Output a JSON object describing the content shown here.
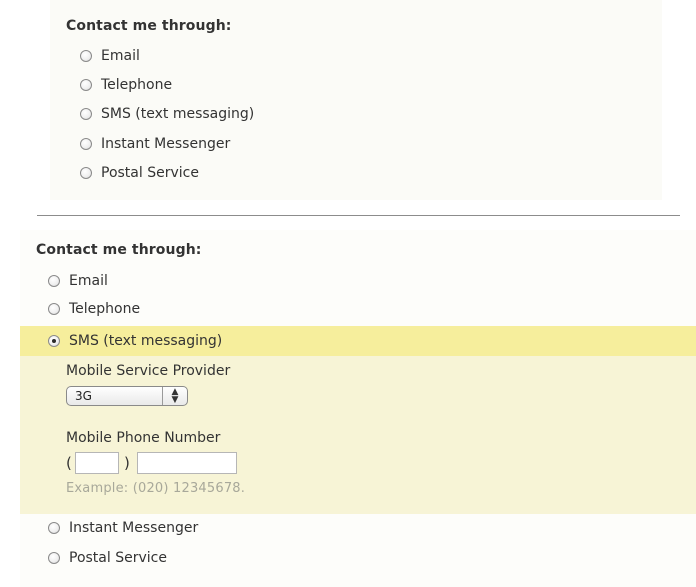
{
  "top_form": {
    "heading": "Contact me through:",
    "options": [
      {
        "label": "Email"
      },
      {
        "label": "Telephone"
      },
      {
        "label": "SMS (text messaging)"
      },
      {
        "label": "Instant Messenger"
      },
      {
        "label": "Postal Service"
      }
    ]
  },
  "bottom_form": {
    "heading": "Contact me through:",
    "options": [
      {
        "label": "Email",
        "checked": false
      },
      {
        "label": "Telephone",
        "checked": false
      },
      {
        "label": "SMS (text messaging)",
        "checked": true
      },
      {
        "label": "Instant Messenger",
        "checked": false
      },
      {
        "label": "Postal Service",
        "checked": false
      }
    ],
    "sms_details": {
      "provider_label": "Mobile Service Provider",
      "provider_selected": "3G",
      "phone_label": "Mobile Phone Number",
      "paren_open": "(",
      "paren_close": ")",
      "area_code_value": "",
      "number_value": "",
      "example": "Example: (020) 12345678."
    }
  },
  "colors": {
    "highlight_row": "#f6ee9c",
    "highlight_panel": "#f7f4d6",
    "hint_text": "#a8a89a"
  }
}
